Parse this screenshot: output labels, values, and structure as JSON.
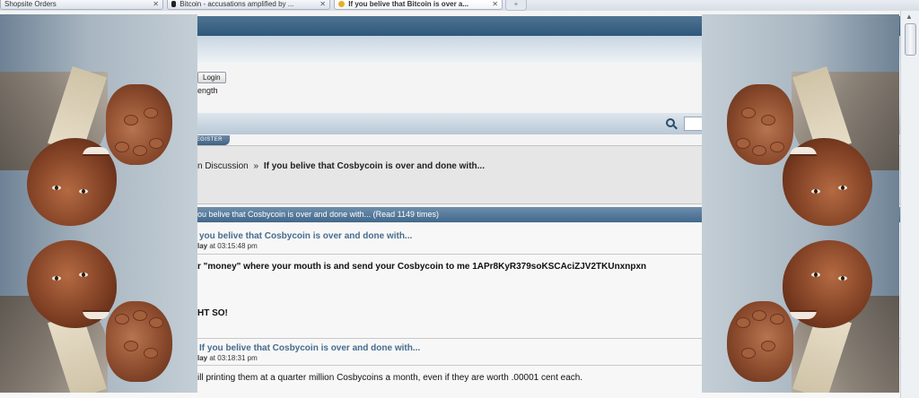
{
  "browser": {
    "tabs": [
      {
        "label": "Shopsite Orders",
        "active": false
      },
      {
        "label": "Bitcoin - accusations amplified by ...",
        "active": false
      },
      {
        "label": "If you belive that Bitcoin is over a...",
        "active": true
      }
    ]
  },
  "header": {
    "login_button": "Login",
    "session_length_text": "ength",
    "register_tab": "REGISTER"
  },
  "breadcrumb": {
    "prefix": "n Discussion",
    "separator": "»",
    "topic": "If you belive that Cosbycoin is over and done with..."
  },
  "topic_bar": {
    "text": "ou belive that Cosbycoin is over and done with...  (Read 1149 times)"
  },
  "posts": [
    {
      "title": "you belive that Cosbycoin is over and done with...",
      "date_prefix": "lay",
      "date_rest": "at 03:15:48 pm",
      "body_lines": [
        "r \"money\" where your mouth is and send your Cosbycoin to me 1APr8KyR379soKSCAciZJV2TKUnxnpxn",
        "HT SO!"
      ]
    },
    {
      "title": "If you belive that Cosbycoin is over and done with...",
      "date_prefix": "lay",
      "date_rest": "at 03:18:31 pm",
      "body_lines": [
        "ill printing them at a quarter million Cosbycoins a month,  even if they are worth .00001 cent each."
      ]
    }
  ],
  "colors": {
    "header_band": "#3f6283",
    "post_title": "#476c8e",
    "topic_bar": "#41688c"
  }
}
